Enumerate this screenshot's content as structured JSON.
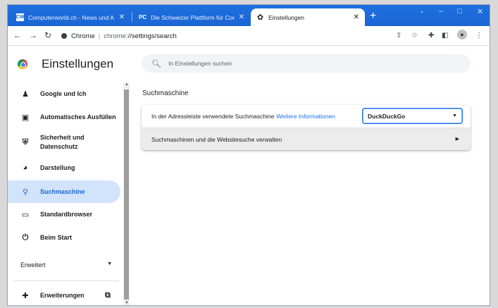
{
  "tabs": [
    {
      "title": "Computerworld.ch - News und A",
      "favicon": "CW",
      "active": false
    },
    {
      "title": "Die Schweizer Plattform für Com",
      "favicon": "PC",
      "active": false
    },
    {
      "title": "Einstellungen",
      "favicon": "gear-icon",
      "active": true
    }
  ],
  "window_controls": {
    "minimize": "–",
    "maximize": "□",
    "close": "✕"
  },
  "address": {
    "site": "Chrome",
    "url_host": "chrome:",
    "url_path": "//settings/search"
  },
  "settings": {
    "title": "Einstellungen",
    "search_placeholder": "In Einstellungen suchen"
  },
  "sidebar": {
    "items": [
      {
        "label": "Google und Ich",
        "icon": "person-icon"
      },
      {
        "label": "Automatisches Ausfüllen",
        "icon": "clipboard-icon"
      },
      {
        "label": "Sicherheit und",
        "label2": "Datenschutz",
        "icon": "shield-icon"
      },
      {
        "label": "Darstellung",
        "icon": "palette-icon"
      },
      {
        "label": "Suchmaschine",
        "icon": "search-icon",
        "active": true
      },
      {
        "label": "Standardbrowser",
        "icon": "browser-window-icon"
      },
      {
        "label": "Beim Start",
        "icon": "power-icon"
      }
    ],
    "advanced": "Erweitert",
    "extensions": "Erweiterungen"
  },
  "main": {
    "section_title": "Suchmaschine",
    "row1_label": "In der Adressleiste verwendete Suchmaschine",
    "row1_link": "Weitere Informationen",
    "engine_selected": "DuckDuckGo",
    "row2_label": "Suchmaschinen und die Websitesuche verwalten"
  },
  "colors": {
    "accent": "#1a73e8",
    "tabstrip": "#1b66d4",
    "active_nav_bg": "#d2e3fc"
  }
}
